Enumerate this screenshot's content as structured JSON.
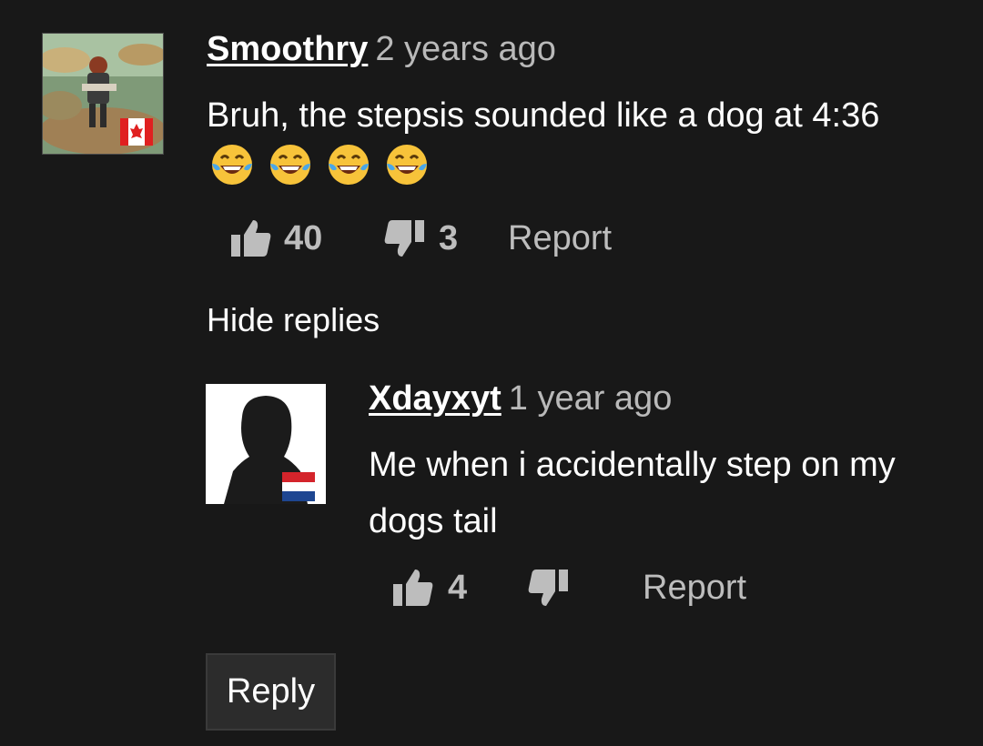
{
  "comment": {
    "username": "Smoothry",
    "timestamp": "2 years ago",
    "text": "Bruh, the stepsis sounded like a dog at 4:36",
    "emojis": [
      "face-with-tears-of-joy",
      "face-with-tears-of-joy",
      "face-with-tears-of-joy",
      "face-with-tears-of-joy"
    ],
    "flag": "canada",
    "likes": "40",
    "dislikes": "3",
    "report_label": "Report"
  },
  "hide_replies_label": "Hide replies",
  "reply": {
    "username": "Xdayxyt",
    "timestamp": "1 year ago",
    "text": "Me when i accidentally step on my dogs tail",
    "flag": "netherlands",
    "likes": "4",
    "dislikes": "",
    "report_label": "Report"
  },
  "reply_button_label": "Reply",
  "colors": {
    "background": "#181818",
    "text": "#ffffff",
    "muted": "#bdbdbd",
    "button_bg": "#2c2c2c"
  }
}
